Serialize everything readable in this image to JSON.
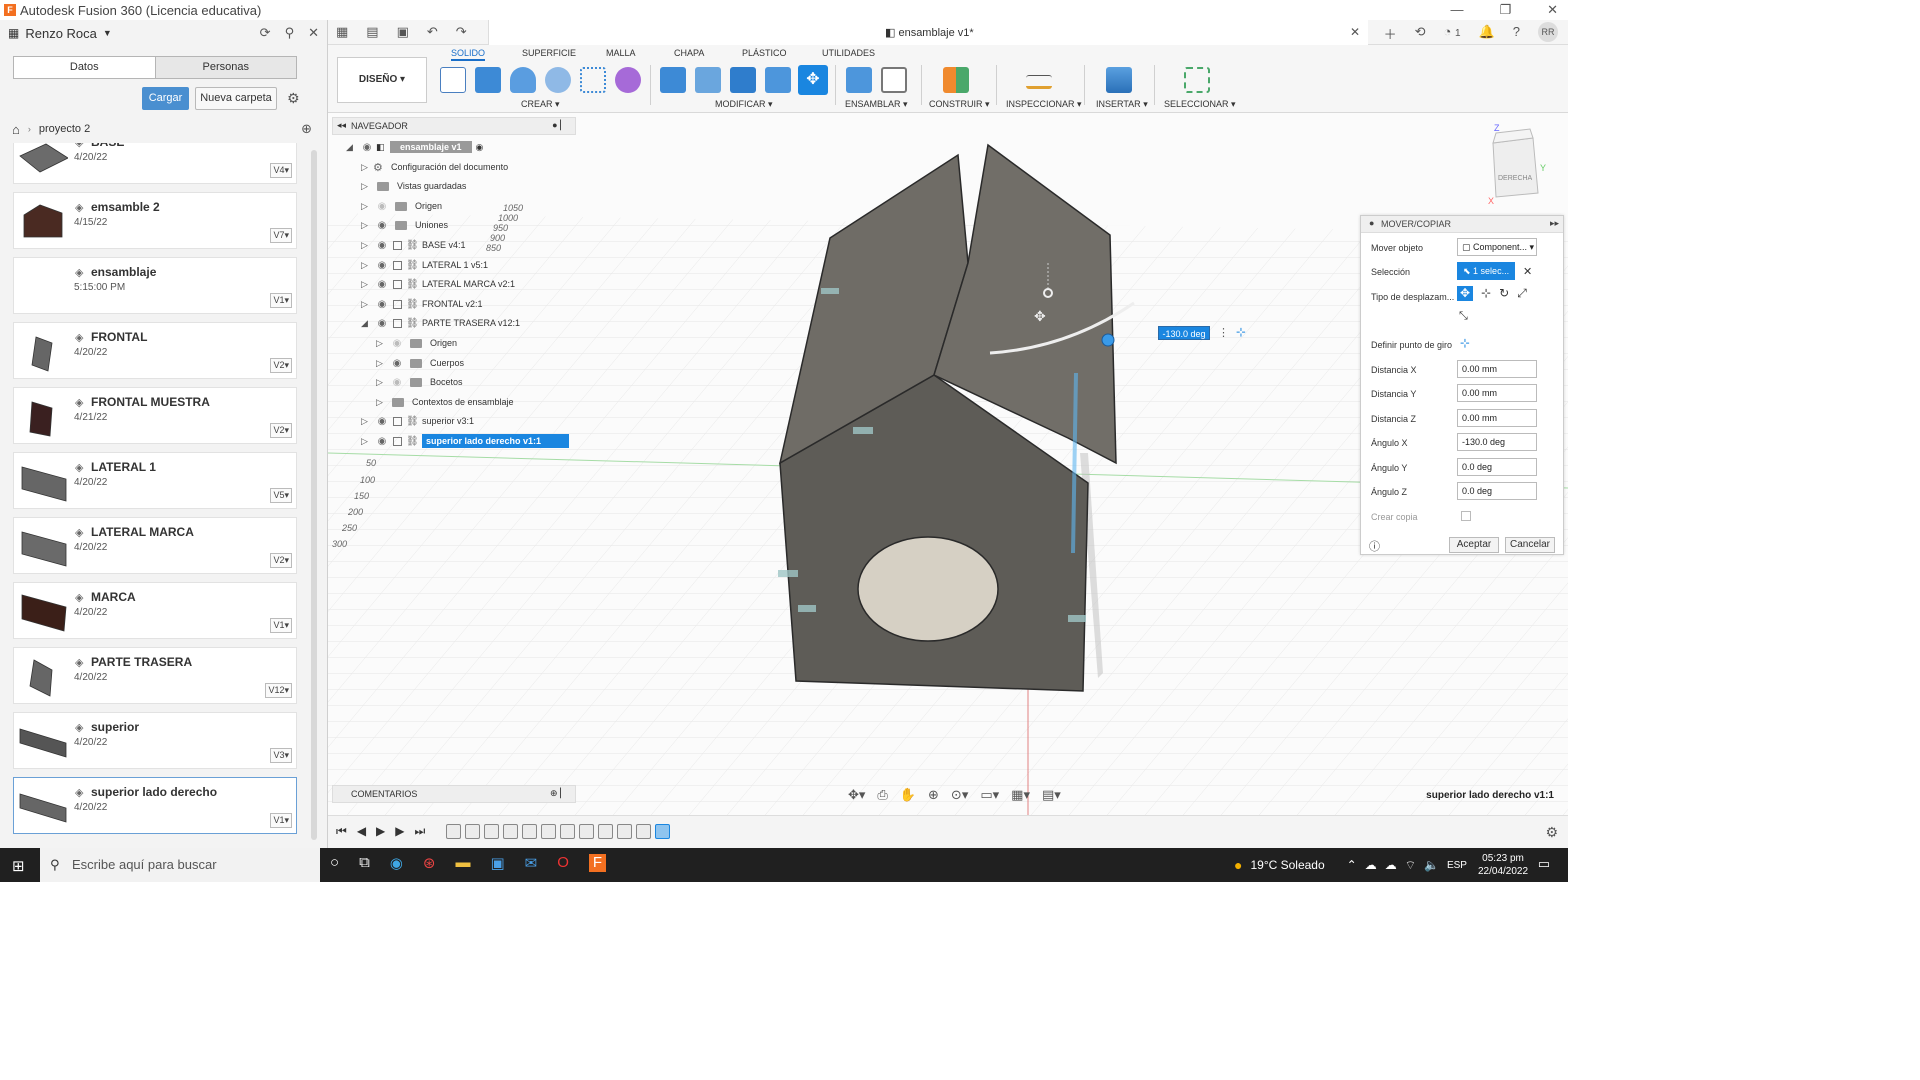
{
  "window": {
    "title": "Autodesk Fusion 360 (Licencia educativa)",
    "app_icon": "F"
  },
  "data_panel": {
    "user": "Renzo Roca",
    "tabs": [
      "Datos",
      "Personas"
    ],
    "upload_label": "Cargar",
    "new_folder_label": "Nueva carpeta",
    "project": "proyecto 2",
    "files": [
      {
        "name": "BASE",
        "date": "4/20/22",
        "version": "V4"
      },
      {
        "name": "emsamble 2",
        "date": "4/15/22",
        "version": "V7"
      },
      {
        "name": "ensamblaje",
        "date": "5:15:00 PM",
        "version": "V1"
      },
      {
        "name": "FRONTAL",
        "date": "4/20/22",
        "version": "V2"
      },
      {
        "name": "FRONTAL MUESTRA",
        "date": "4/21/22",
        "version": "V2"
      },
      {
        "name": "LATERAL 1",
        "date": "4/20/22",
        "version": "V5"
      },
      {
        "name": "LATERAL MARCA",
        "date": "4/20/22",
        "version": "V2"
      },
      {
        "name": "MARCA",
        "date": "4/20/22",
        "version": "V1"
      },
      {
        "name": "PARTE TRASERA",
        "date": "4/20/22",
        "version": "V12"
      },
      {
        "name": "superior",
        "date": "4/20/22",
        "version": "V3"
      },
      {
        "name": "superior lado derecho",
        "date": "4/20/22",
        "version": "V1"
      }
    ]
  },
  "document": {
    "tab_title": "ensamblaje v1*",
    "notifications": "1",
    "avatar": "RR"
  },
  "ribbon": {
    "workspace": "DISEÑO",
    "tabs": [
      "SOLIDO",
      "SUPERFICIE",
      "MALLA",
      "CHAPA",
      "PLÁSTICO",
      "UTILIDADES"
    ],
    "groups": [
      "CREAR",
      "MODIFICAR",
      "ENSAMBLAR",
      "CONSTRUIR",
      "INSPECCIONAR",
      "INSERTAR",
      "SELECCIONAR"
    ]
  },
  "navigator": {
    "title": "NAVEGADOR",
    "root": "ensamblaje v1",
    "items": [
      "Configuración del documento",
      "Vistas guardadas",
      "Origen",
      "Uniones",
      "BASE v4:1",
      "LATERAL 1 v5:1",
      "LATERAL MARCA v2:1",
      "FRONTAL v2:1",
      "PARTE TRASERA v12:1",
      "Origen",
      "Cuerpos",
      "Bocetos",
      "Contextos de ensamblaje",
      "superior v3:1",
      "superior lado derecho v1:1"
    ]
  },
  "comments_label": "COMENTARIOS",
  "viewcube_label": "DERECHA",
  "viewcube_axes": {
    "z": "Z",
    "x": "X",
    "y": "Y"
  },
  "angle_input": "-130.0 deg",
  "ruler": [
    "1050",
    "1000",
    "950",
    "900",
    "850",
    "50",
    "100",
    "150",
    "200",
    "250",
    "300"
  ],
  "dialog": {
    "title": "MOVER/COPIAR",
    "fields": {
      "mover_objeto_label": "Mover objeto",
      "mover_objeto_value": "Component...",
      "seleccion_label": "Selección",
      "seleccion_value": "1 selec...",
      "tipo_label": "Tipo de desplazam...",
      "punto_label": "Definir punto de giro",
      "dx_label": "Distancia X",
      "dx": "0.00 mm",
      "dy_label": "Distancia Y",
      "dy": "0.00 mm",
      "dz_label": "Distancia Z",
      "dz": "0.00 mm",
      "ax_label": "Ángulo X",
      "ax": "-130.0 deg",
      "ay_label": "Ángulo Y",
      "ay": "0.0 deg",
      "az_label": "Ángulo Z",
      "az": "0.0 deg",
      "copy_label": "Crear copia"
    },
    "ok": "Aceptar",
    "cancel": "Cancelar"
  },
  "status_selection": "superior lado derecho v1:1",
  "taskbar": {
    "search_placeholder": "Escribe aquí para buscar",
    "weather": "19°C  Soleado",
    "lang": "ESP",
    "time": "05:23 pm",
    "date": "22/04/2022"
  },
  "colors": {
    "accent": "#1a86e0",
    "model_dark": "#5a5853",
    "model_light": "#6b6862",
    "hole": "#d6d0c4"
  }
}
